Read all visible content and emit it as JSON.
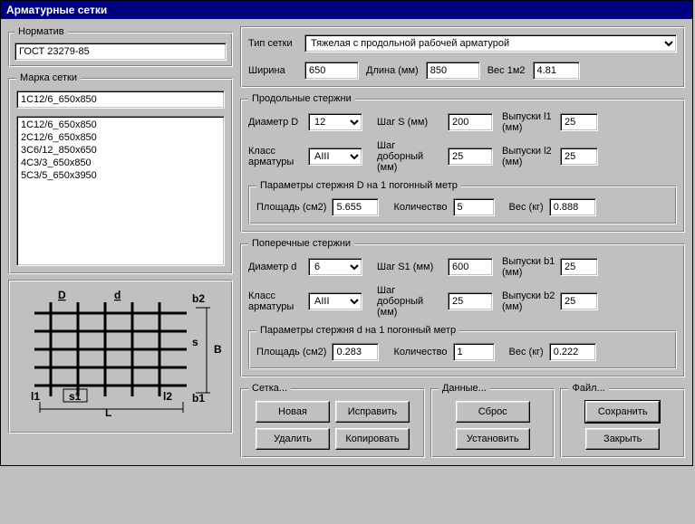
{
  "title": "Арматурные сетки",
  "normative": {
    "legend": "Норматив",
    "value": "ГОСТ 23279-85"
  },
  "brand": {
    "legend": "Марка сетки",
    "current": "1С12/6_650х850",
    "items": [
      "1С12/6_650х850",
      "2С12/6_650х850",
      "3С6/12_850х650",
      "4С3/3_650х850",
      "5С3/5_650х3950"
    ]
  },
  "diagram_labels": {
    "D": "D",
    "d": "d",
    "b1": "b1",
    "b2": "b2",
    "l1": "l1",
    "l2": "l2",
    "s": "s",
    "s1": "s1",
    "L": "L",
    "B": "B"
  },
  "top_group": {
    "type_label": "Тип сетки",
    "type_value": "Тяжелая с продольной рабочей арматурой",
    "width_label": "Ширина",
    "width_value": "650",
    "length_label": "Длина (мм)",
    "length_value": "850",
    "weight_label": "Вес 1м2",
    "weight_value": "4.81"
  },
  "longitudinal": {
    "legend": "Продольные стержни",
    "diameter_label": "Диаметр D",
    "diameter_value": "12",
    "step_label": "Шаг S (мм)",
    "step_value": "200",
    "out1_label": "Выпуски l1 (мм)",
    "out1_value": "25",
    "class_label": "Класс арматуры",
    "class_value": "AIII",
    "step_add_label": "Шаг доборный (мм)",
    "step_add_value": "25",
    "out2_label": "Выпуски l2 (мм)",
    "out2_value": "25",
    "param_legend": "Параметры стержня D на 1 погонный метр",
    "area_label": "Площадь (см2)",
    "area_value": "5.655",
    "count_label": "Количество",
    "count_value": "5",
    "w_label": "Вес (кг)",
    "w_value": "0.888"
  },
  "transverse": {
    "legend": "Поперечные стержни",
    "diameter_label": "Диаметр d",
    "diameter_value": "6",
    "step_label": "Шаг S1 (мм)",
    "step_value": "600",
    "out1_label": "Выпуски b1 (мм)",
    "out1_value": "25",
    "class_label": "Класс арматуры",
    "class_value": "AIII",
    "step_add_label": "Шаг доборный (мм)",
    "step_add_value": "25",
    "out2_label": "Выпуски b2 (мм)",
    "out2_value": "25",
    "param_legend": "Параметры стержня d на 1 погонный метр",
    "area_label": "Площадь (см2)",
    "area_value": "0.283",
    "count_label": "Количество",
    "count_value": "1",
    "w_label": "Вес (кг)",
    "w_value": "0.222"
  },
  "buttons": {
    "mesh_legend": "Сетка...",
    "new": "Новая",
    "fix": "Исправить",
    "delete": "Удалить",
    "copy": "Копировать",
    "data_legend": "Данные...",
    "reset": "Сброс",
    "apply": "Установить",
    "file_legend": "Файл...",
    "save": "Сохранить",
    "close": "Закрыть"
  }
}
